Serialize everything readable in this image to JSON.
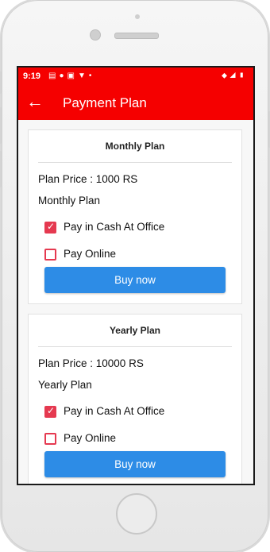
{
  "status": {
    "time": "9:19",
    "icons_left": [
      "notification-icon",
      "location-pin-icon",
      "message-icon",
      "arrow-icon",
      "dot-icon"
    ],
    "icons_right": [
      "wifi-icon",
      "signal-icon",
      "battery-icon"
    ]
  },
  "appbar": {
    "back_icon": "back-arrow-icon",
    "title": "Payment Plan"
  },
  "plans": [
    {
      "header": "Monthly Plan",
      "price": "Plan Price : 1000 RS",
      "name": "Monthly Plan",
      "options": [
        {
          "label": "Pay in Cash At Office",
          "checked": true
        },
        {
          "label": "Pay Online",
          "checked": false
        }
      ],
      "button": "Buy now"
    },
    {
      "header": "Yearly Plan",
      "price": "Plan Price : 10000 RS",
      "name": "Yearly Plan",
      "options": [
        {
          "label": "Pay in Cash At Office",
          "checked": true
        },
        {
          "label": "Pay Online",
          "checked": false
        }
      ],
      "button": "Buy now"
    }
  ],
  "colors": {
    "primary": "#f50000",
    "checkbox": "#e53950",
    "button": "#2d8ce6"
  }
}
